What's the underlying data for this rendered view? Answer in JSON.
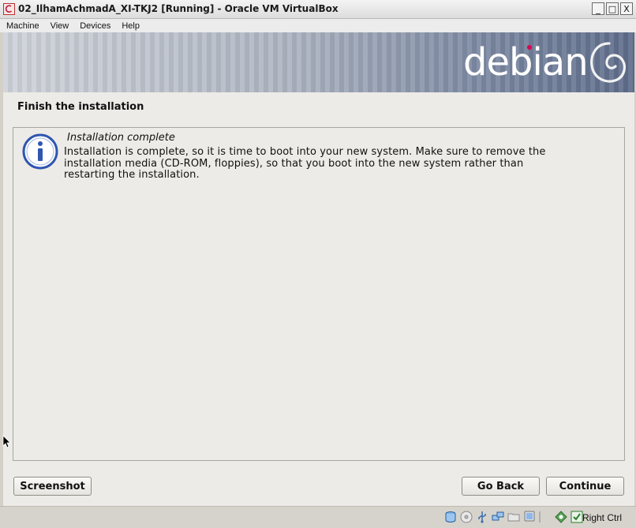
{
  "window": {
    "title": "02_IlhamAchmadA_XI-TKJ2 [Running] - Oracle VM VirtualBox",
    "buttons": [
      "_",
      "□",
      "X"
    ]
  },
  "menu": [
    "Machine",
    "View",
    "Devices",
    "Help"
  ],
  "banner": {
    "logo_text": "debian"
  },
  "page": {
    "title": "Finish the installation",
    "message_heading": "Installation complete",
    "message_body_lines": [
      "Installation is complete, so it is time to boot into your new system. Make sure to remove the",
      "installation media (CD-ROM, floppies), so that you boot into the new system rather than",
      "restarting the installation."
    ]
  },
  "buttons": {
    "screenshot": "Screenshot",
    "go_back": "Go Back",
    "continue": "Continue"
  },
  "statusbar": {
    "icons": [
      "hard-disk-icon",
      "optical-drive-icon",
      "usb-icon",
      "network-icon",
      "shared-folders-icon",
      "display-icon",
      "video-capture-icon",
      "cpu-icon",
      "mouse-integration-icon"
    ],
    "host_key": "Right Ctrl"
  }
}
